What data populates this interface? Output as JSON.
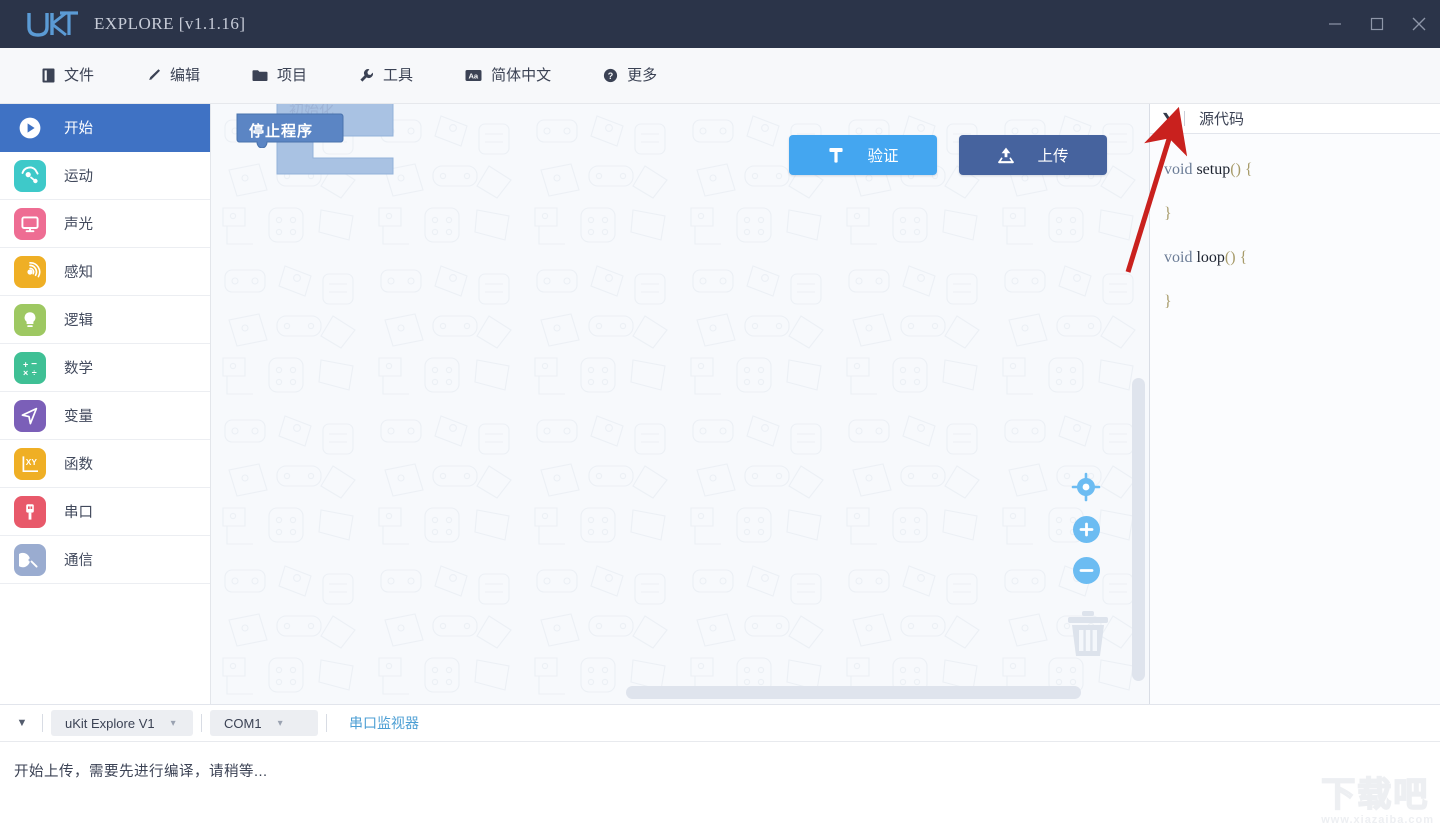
{
  "window": {
    "brand": "uKIT",
    "title": "EXPLORE [v1.1.16]",
    "minimize_label": "Minimize",
    "maximize_label": "Maximize",
    "close_label": "Close"
  },
  "menubar": {
    "items": [
      {
        "label": "文件",
        "icon": "file-icon"
      },
      {
        "label": "编辑",
        "icon": "pen-icon"
      },
      {
        "label": "项目",
        "icon": "folder-icon"
      },
      {
        "label": "工具",
        "icon": "wrench-icon"
      },
      {
        "label": "简体中文",
        "icon": "language-icon"
      },
      {
        "label": "更多",
        "icon": "help-icon"
      }
    ]
  },
  "sidebar": {
    "items": [
      {
        "label": "开始",
        "icon": "play-icon",
        "color": "#ffffff",
        "active": true
      },
      {
        "label": "运动",
        "icon": "motion-icon",
        "color": "#3ec9c9",
        "active": false
      },
      {
        "label": "声光",
        "icon": "display-icon",
        "color": "#ee6d93",
        "active": false
      },
      {
        "label": "感知",
        "icon": "sensor-icon",
        "color": "#efaf25",
        "active": false
      },
      {
        "label": "逻辑",
        "icon": "bulb-icon",
        "color": "#9cc martin",
        "active": false
      },
      {
        "label": "数学",
        "icon": "math-icon",
        "color": "#3fc095",
        "active": false
      },
      {
        "label": "变量",
        "icon": "variable-icon",
        "color": "#7b5fb8",
        "active": false
      },
      {
        "label": "函数",
        "icon": "function-icon",
        "color": "#efaf25",
        "active": false
      },
      {
        "label": "串口",
        "icon": "usb-icon",
        "color": "#e8596a",
        "active": false
      },
      {
        "label": "通信",
        "icon": "antenna-icon",
        "color": "#9aacd0",
        "active": false
      }
    ]
  },
  "toolbar": {
    "verify_label": "验证",
    "verify_icon": "hammer-icon",
    "verify_color": "#44a6f0",
    "upload_label": "上传",
    "upload_icon": "upload-icon",
    "upload_color": "#46639e"
  },
  "canvas": {
    "block_init_label": "初始化",
    "block_stop_label": "停止程序",
    "center_icon": "center-target-icon",
    "zoom_in_icon": "zoom-in-icon",
    "zoom_out_icon": "zoom-out-icon",
    "trash_icon": "trash-icon"
  },
  "code_panel": {
    "toggle_icon": "chevron-right-icon",
    "title": "源代码",
    "lines": [
      {
        "kw": "void",
        "fn": "setup",
        "paren": "()",
        "brace": "{"
      },
      {
        "brace_close": "}"
      },
      {
        "kw": "void",
        "fn": "loop",
        "paren": "()",
        "brace": "{"
      },
      {
        "brace_close": "}"
      }
    ],
    "text": "void setup() {\n\n}\n\nvoid loop() {\n\n}"
  },
  "statusbar": {
    "caret_icon": "chevron-down-icon",
    "device": {
      "value": "uKit Explore V1",
      "caret": "▾"
    },
    "port": {
      "value": "COM1",
      "caret": "▾"
    },
    "serial_monitor_label": "串口监视器",
    "link_color": "#4d9fd4"
  },
  "log": {
    "message": "开始上传，需要先进行编译，请稍等..."
  },
  "watermark": {
    "text": "下载吧",
    "url": "www.xiazaiba.com"
  },
  "annotation": {
    "arrow_color": "#c9211e",
    "arrow_name": "red-pointer-arrow"
  }
}
